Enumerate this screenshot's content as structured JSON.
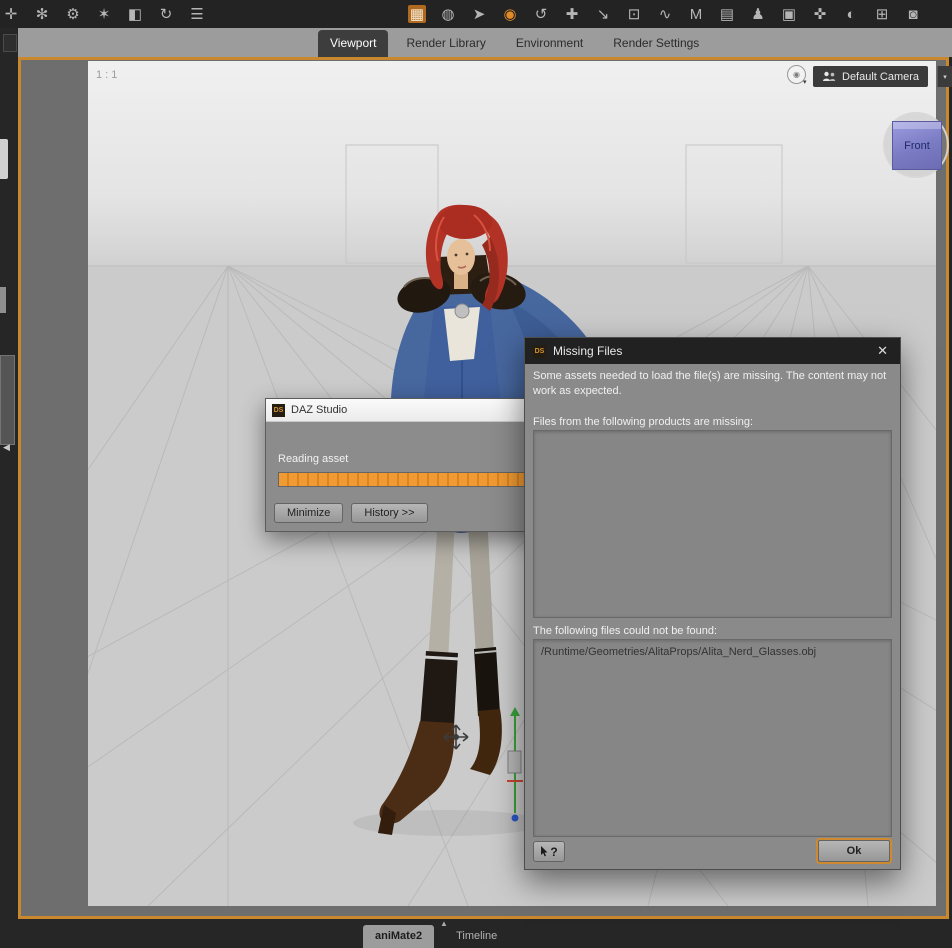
{
  "colors": {
    "viewport_border_accent": "#c9882e",
    "toolbar_accent_orange": "#e08a28",
    "progress_fill_orange": "#f09a33",
    "ok_focus_ring": "#cf8a2f",
    "view_cube_purple": "#7b7bc4"
  },
  "toolbar": {
    "left_icons": [
      {
        "name": "node-tool-icon",
        "glyph": "✛"
      },
      {
        "name": "snowflake-tool-icon",
        "glyph": "✻"
      },
      {
        "name": "gear-tool-icon",
        "glyph": "⚙"
      },
      {
        "name": "wand-tool-icon",
        "glyph": "✶"
      },
      {
        "name": "paint-bucket-tool-icon",
        "glyph": "◧"
      },
      {
        "name": "reload-tool-icon",
        "glyph": "↻"
      },
      {
        "name": "list-tool-icon",
        "glyph": "☰"
      }
    ],
    "right_icons": [
      {
        "name": "uv-grid-tool-icon",
        "glyph": "▦"
      },
      {
        "name": "sphere-tool-icon",
        "glyph": "◍"
      },
      {
        "name": "pointer-tool-icon",
        "glyph": "➤"
      },
      {
        "name": "active-rotate-tool-icon",
        "glyph": "◉"
      },
      {
        "name": "rotate-tool-icon",
        "glyph": "↺"
      },
      {
        "name": "translate-tool-icon",
        "glyph": "✚"
      },
      {
        "name": "scale-tool-icon",
        "glyph": "↘"
      },
      {
        "name": "frame-tool-icon",
        "glyph": "⊡"
      },
      {
        "name": "curve-tool-icon",
        "glyph": "∿"
      },
      {
        "name": "measure-tool-icon",
        "glyph": "M"
      },
      {
        "name": "geometry-tool-icon",
        "glyph": "▤"
      },
      {
        "name": "figure-tool-icon",
        "glyph": "♟"
      },
      {
        "name": "camera-view-tool-icon",
        "glyph": "▣"
      },
      {
        "name": "node-select-tool-icon",
        "glyph": "✜"
      },
      {
        "name": "surface-tool-icon",
        "glyph": "◐"
      },
      {
        "name": "add-camera-tool-icon",
        "glyph": "⊞"
      },
      {
        "name": "render-tool-icon",
        "glyph": "◙"
      }
    ]
  },
  "tab_bar": {
    "tabs": [
      {
        "label": "Viewport",
        "active": true
      },
      {
        "label": "Render Library",
        "active": false
      },
      {
        "label": "Environment",
        "active": false
      },
      {
        "label": "Render Settings",
        "active": false
      }
    ]
  },
  "viewport": {
    "zoom_label": "1 : 1",
    "camera_selector": {
      "label": "Default Camera",
      "dropdown_glyph": "▾"
    },
    "options_icon_glyph": "◉",
    "options_caret_glyph": "▾",
    "view_cube": {
      "label": "Front"
    }
  },
  "progress_dialog": {
    "logo": "DS",
    "title": "DAZ Studio",
    "status_text": "Reading asset",
    "minimize_label": "Minimize",
    "history_label": "History >>"
  },
  "missing_files_dialog": {
    "logo": "DS",
    "title": "Missing Files",
    "close_glyph": "✕",
    "message": "Some assets needed to load the file(s) are missing. The content may not work as expected.",
    "products_label": "Files from the following products are missing:",
    "files_label": "The following files could not be found:",
    "files": [
      "/Runtime/Geometries/AlitaProps/Alita_Nerd_Glasses.obj"
    ],
    "help_label": "?",
    "ok_label": "Ok"
  },
  "bottom_bar": {
    "expand_glyph": "▲",
    "tabs": [
      {
        "label": "aniMate2",
        "active": true
      },
      {
        "label": "Timeline",
        "active": false
      }
    ]
  }
}
